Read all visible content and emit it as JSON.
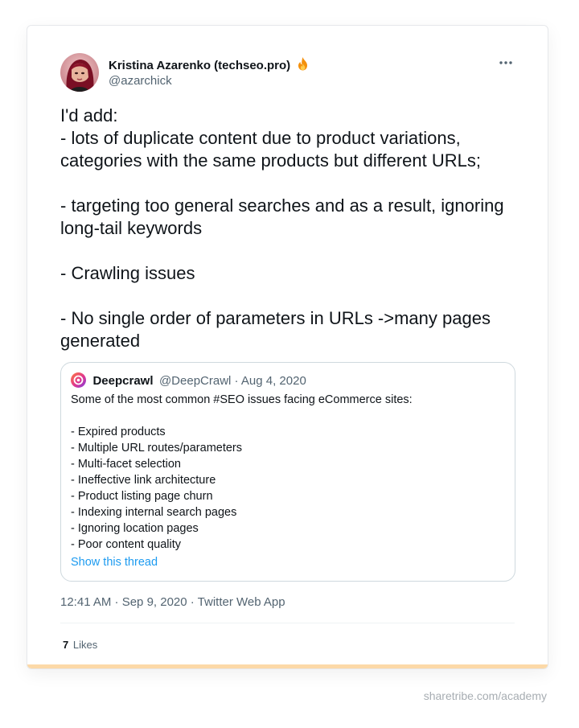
{
  "tweet": {
    "author_name": "Kristina Azarenko (techseo.pro)",
    "author_handle": "@azarchick",
    "text": "I'd add:\n- lots of duplicate content due to product variations, categories with the same products but different URLs;\n\n- targeting too general searches and as a result, ignoring long-tail keywords\n\n- Crawling issues\n\n- No single order of parameters in URLs ->many pages generated",
    "timestamp": "12:41 AM · Sep 9, 2020 · Twitter Web App",
    "likes_count": "7",
    "likes_label": "Likes",
    "icons": {
      "avatar": "avatar",
      "badge": "fire-emoji-icon",
      "menu": "more-options-icon"
    }
  },
  "quoted_tweet": {
    "author_name": "Deepcrawl",
    "meta": "@DeepCrawl · Aug 4, 2020",
    "text": "Some of the most common #SEO issues facing eCommerce sites:\n\n- Expired products\n- Multiple URL routes/parameters\n- Multi-facet selection\n- Ineffective link architecture\n- Product listing page churn\n- Indexing internal search pages\n- Ignoring location pages\n- Poor content quality",
    "show_thread_label": "Show this thread",
    "icon": "deepcrawl-logo-icon"
  },
  "watermark": "sharetribe.com/academy",
  "colors": {
    "text_primary": "#0f1419",
    "text_secondary": "#536471",
    "link": "#1d9bf0",
    "card_accent_bar": "#fcd9a8",
    "border": "#cfd9de"
  }
}
